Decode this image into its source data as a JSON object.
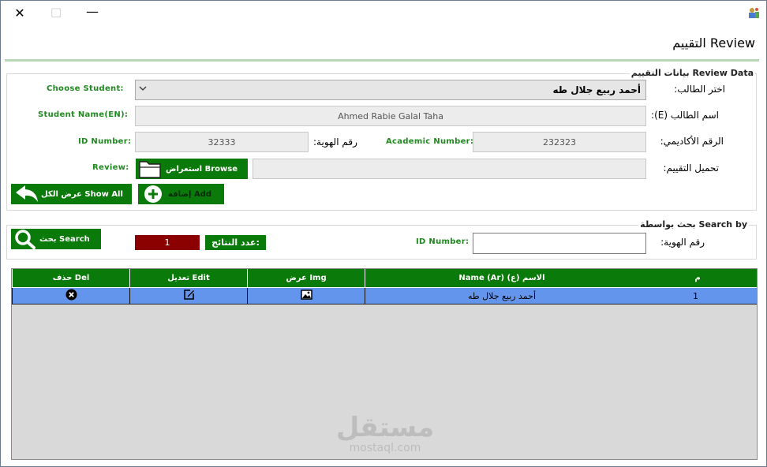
{
  "header": {
    "title": "التقييم Review"
  },
  "review_group": {
    "title": "بيانات التقييم Review Data",
    "choose_student_en": "Choose Student:",
    "choose_student_ar": "اختر الطالب:",
    "choose_student_value": "أحمد ربيع جلال طه",
    "student_name_en": "Student Name(EN):",
    "student_name_ar": "اسم الطالب (E):",
    "student_name_value": "Ahmed Rabie Galal Taha",
    "id_number_en": "ID Number:",
    "id_number_ar": "رقم الهوية:",
    "id_number_value": "32333",
    "academic_number_en": "Academic Number:",
    "academic_number_ar": "الرقم الأكاديمي:",
    "academic_number_value": "232323",
    "review_en": "Review:",
    "review_ar": "تحميل التقييم:",
    "review_value": "",
    "browse_label": "استعراض Browse",
    "show_all_label": "عرض الكل Show All",
    "add_label": "إضافة Add"
  },
  "search_group": {
    "title": "بحث بواسطة Search by",
    "search_label": "بحث Search",
    "result_count": "1",
    "result_count_label": "عدد النتائج:",
    "id_number_en": "ID Number:",
    "id_number_ar": "رقم الهوية:",
    "id_number_value": ""
  },
  "grid": {
    "headers": [
      "م",
      "Name (Ar) (ع) الاسم",
      "عرض Img",
      "تعديل Edit",
      "حذف Del"
    ],
    "rows": [
      {
        "index": "1",
        "name": "أحمد ربيع جلال طه"
      }
    ]
  },
  "watermark": {
    "ar": "مستقل",
    "en": "mostaql.com"
  },
  "icons": {
    "close": "close-icon",
    "maximize": "maximize-icon",
    "minimize": "minimize-icon",
    "app": "app-icon",
    "folder": "folder-icon",
    "back": "back-arrow-icon",
    "add": "plus-circle-icon",
    "search": "search-icon",
    "image": "image-icon",
    "edit": "edit-icon",
    "delete": "delete-icon"
  },
  "colors": {
    "accent": "#0a7a0a",
    "label_green": "#1f8a1f",
    "row_selected": "#6495ed",
    "count_box": "#8b0000"
  }
}
